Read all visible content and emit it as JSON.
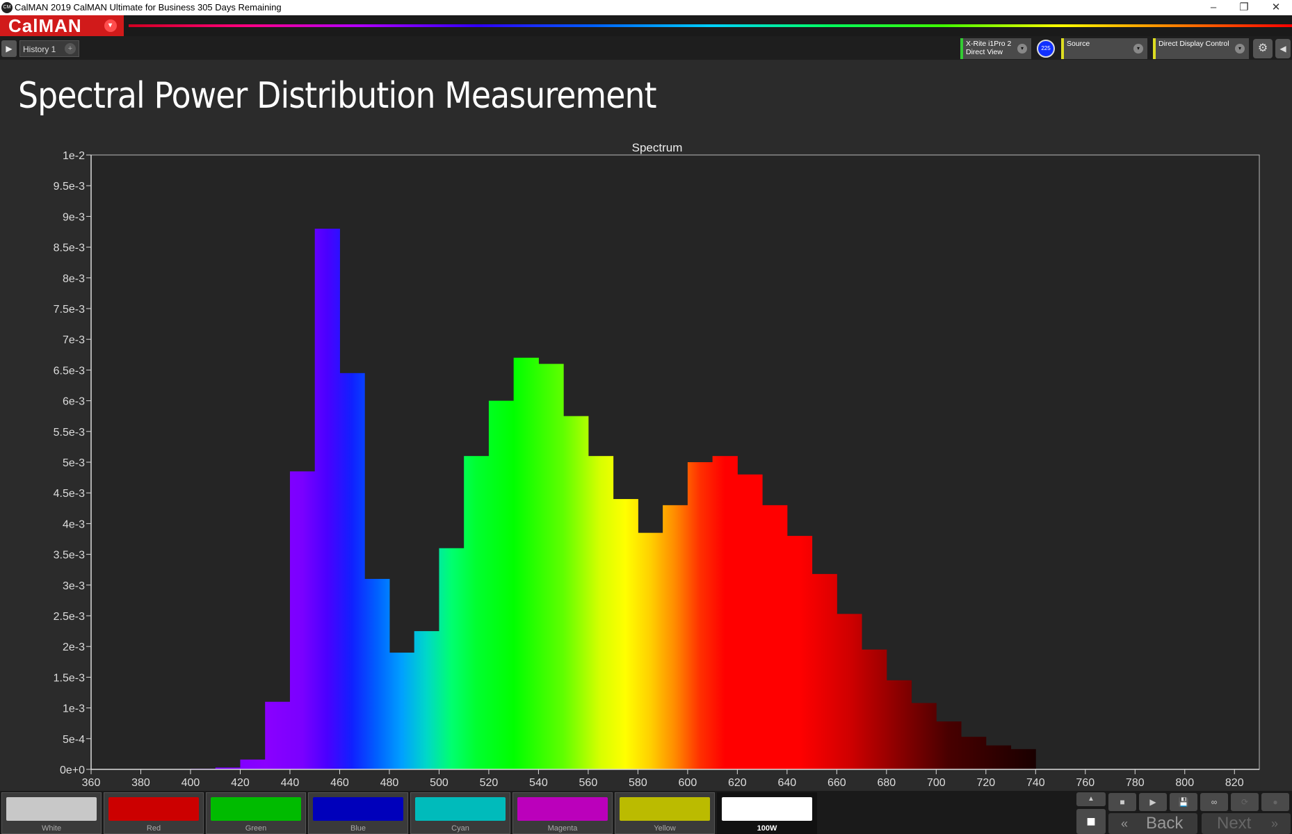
{
  "window": {
    "title": "CalMAN 2019 CalMAN Ultimate for Business 305 Days Remaining",
    "app_icon": "CM",
    "minimize": "–",
    "restore": "❐",
    "close": "✕"
  },
  "logo": {
    "text": "CalMAN",
    "menu_glyph": "▾"
  },
  "tabs": {
    "play_glyph": "▶",
    "history_tab": "History 1",
    "add_glyph": "+"
  },
  "devices": {
    "meter_line1": "X-Rite i1Pro 2",
    "meter_line2": "Direct View",
    "meter_badge": "225",
    "source": "Source",
    "display": "Direct Display Control",
    "dropdown_glyph": "▾",
    "gear_glyph": "⚙",
    "collapse_glyph": "◀"
  },
  "page": {
    "title": "Spectral Power Distribution Measurement"
  },
  "chart_data": {
    "type": "bar",
    "title": "Spectrum",
    "x_ticks": [
      360,
      380,
      400,
      420,
      440,
      460,
      480,
      500,
      520,
      540,
      560,
      580,
      600,
      620,
      640,
      660,
      680,
      700,
      720,
      740,
      760,
      780,
      800,
      820
    ],
    "y_ticks": [
      "0e+0",
      "5e-4",
      "1e-3",
      "1.5e-3",
      "2e-3",
      "2.5e-3",
      "3e-3",
      "3.5e-3",
      "4e-3",
      "4.5e-3",
      "5e-3",
      "5.5e-3",
      "6e-3",
      "6.5e-3",
      "7e-3",
      "7.5e-3",
      "8e-3",
      "8.5e-3",
      "9e-3",
      "9.5e-3",
      "1e-2"
    ],
    "xlim": [
      360,
      830
    ],
    "ylim": [
      0,
      0.01
    ],
    "bin_width": 10,
    "bins_start": [
      380,
      390,
      400,
      410,
      420,
      430,
      440,
      450,
      460,
      470,
      480,
      490,
      500,
      510,
      520,
      530,
      540,
      550,
      560,
      570,
      580,
      590,
      600,
      610,
      620,
      630,
      640,
      650,
      660,
      670,
      680,
      690,
      700,
      710,
      720,
      730
    ],
    "values": [
      0.0,
      0.0,
      1e-05,
      3e-05,
      0.00016,
      0.0011,
      0.00485,
      0.0088,
      0.00645,
      0.0031,
      0.0019,
      0.00225,
      0.0036,
      0.0051,
      0.006,
      0.0067,
      0.0066,
      0.00575,
      0.0051,
      0.0044,
      0.00385,
      0.0043,
      0.005,
      0.0051,
      0.0048,
      0.0043,
      0.0038,
      0.00318,
      0.00253,
      0.00195,
      0.00145,
      0.00108,
      0.00078,
      0.00053,
      0.00039,
      0.00033
    ],
    "grid": false
  },
  "swatches": [
    {
      "label": "White",
      "color": "#c8c8c8"
    },
    {
      "label": "Red",
      "color": "#cc0000"
    },
    {
      "label": "Green",
      "color": "#00bb00"
    },
    {
      "label": "Blue",
      "color": "#0000bb"
    },
    {
      "label": "Cyan",
      "color": "#00bbbb"
    },
    {
      "label": "Magenta",
      "color": "#bb00bb"
    },
    {
      "label": "Yellow",
      "color": "#bbbb00"
    },
    {
      "label": "100W",
      "color": "#ffffff"
    }
  ],
  "controls": {
    "up_glyph": "▲",
    "stop_glyph": "■",
    "play_glyph": "▶",
    "save_glyph": "💾",
    "loop_glyph": "∞",
    "refresh_glyph": "⟳",
    "circle_glyph": "●",
    "big_stop_glyph": "■",
    "back_label": "Back",
    "next_label": "Next",
    "back_glyph": "«",
    "next_glyph": "»"
  }
}
